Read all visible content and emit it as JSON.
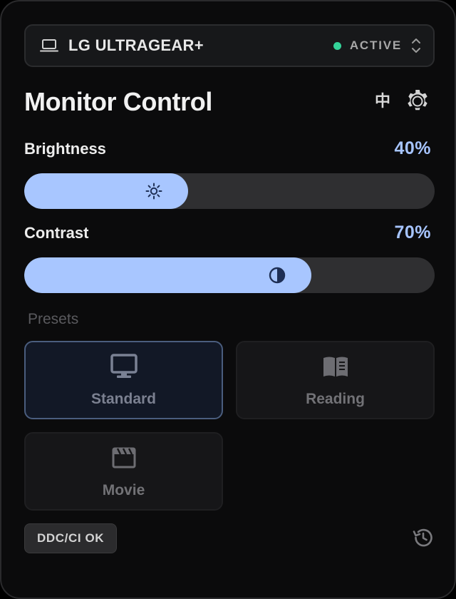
{
  "monitor": {
    "name": "LG ULTRAGEAR+",
    "status": "ACTIVE",
    "status_color": "#34d399"
  },
  "header": {
    "title": "Monitor Control",
    "language_label": "中",
    "settings_icon": "gear-icon"
  },
  "brightness": {
    "label": "Brightness",
    "value_text": "40%",
    "value": 40,
    "icon": "sun-icon"
  },
  "contrast": {
    "label": "Contrast",
    "value_text": "70%",
    "value": 70,
    "icon": "contrast-icon"
  },
  "presets": {
    "title": "Presets",
    "items": [
      {
        "label": "Standard",
        "icon": "monitor-icon",
        "active": true
      },
      {
        "label": "Reading",
        "icon": "book-icon",
        "active": false
      },
      {
        "label": "Movie",
        "icon": "clapperboard-icon",
        "active": false
      }
    ]
  },
  "footer": {
    "ddc_status": "DDC/CI OK",
    "history_icon": "history-icon"
  },
  "colors": {
    "accent": "#a8c6ff",
    "value_text": "#a6c4ff",
    "background": "#0b0b0c"
  }
}
